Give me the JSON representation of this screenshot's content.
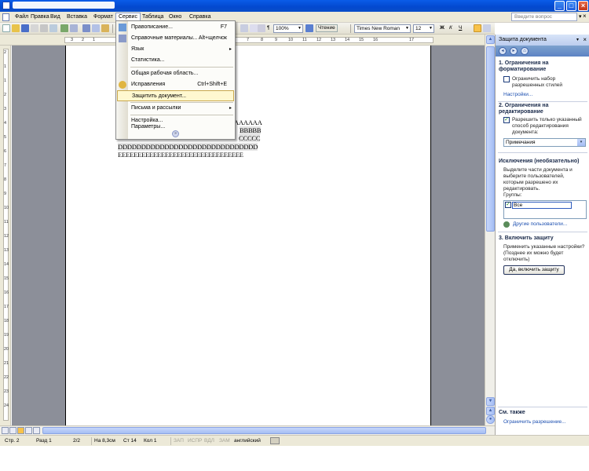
{
  "window": {
    "title": "",
    "minimize": "_",
    "maximize": "□",
    "close": "×"
  },
  "menubar": {
    "items": [
      "Файл",
      "Правка",
      "Вид",
      "Вставка",
      "Формат",
      "Сервис",
      "Таблица",
      "Окно",
      "Справка"
    ],
    "active": "Сервис",
    "help_placeholder": "Введите вопрос",
    "help_arrow": "▾",
    "close_doc": "×"
  },
  "toolbar": {
    "zoom": "100%",
    "read_button": "Чтение",
    "font": "Times New Roman",
    "size": "12",
    "bold": "Ж",
    "italic": "К",
    "underline": "Ч",
    "paragraph_mark": "¶",
    "font_color": "A"
  },
  "ruler": {
    "h_ticks": [
      "3",
      "2",
      "1",
      "1",
      "2",
      "3",
      "4",
      "5",
      "6",
      "7",
      "8",
      "9",
      "10",
      "11",
      "12",
      "13",
      "14",
      "15",
      "16",
      "17"
    ],
    "v_ticks": [
      "2",
      "1",
      "1",
      "2",
      "3",
      "4",
      "5",
      "6",
      "7",
      "8",
      "9",
      "10",
      "11",
      "12",
      "13",
      "14",
      "15",
      "16",
      "17",
      "18",
      "19",
      "20",
      "21",
      "22",
      "23",
      "24"
    ]
  },
  "document": {
    "lines": [
      "AAAAAA",
      "BBBBB",
      "CCCCC",
      "DDDDDDDDDDDDDDDDDDDDDDDDDDDDDD",
      "EEEEEEEEEEEEEEEEEEEEEEEEEEEEEEEE"
    ]
  },
  "dropdown": {
    "items": [
      {
        "label": "Правописание...",
        "key": "F7",
        "icon": "spelling-icon"
      },
      {
        "label": "Справочные материалы...",
        "key": "Alt+щелчок",
        "icon": "research-icon"
      },
      {
        "label": "Язык",
        "submenu": true
      },
      {
        "label": "Статистика..."
      },
      {
        "label": "Общая рабочая область..."
      },
      {
        "label": "Исправления",
        "key": "Ctrl+Shift+E",
        "icon": "track-changes-icon"
      },
      {
        "label": "Защитить документ...",
        "highlighted": true
      },
      {
        "label": "Письма и рассылки",
        "submenu": true
      },
      {
        "label": "Настройка..."
      },
      {
        "label": "Параметры..."
      }
    ],
    "submenu_arrow": "▸",
    "more_arrow": "»"
  },
  "statusbar": {
    "page": "Стр. 2",
    "section": "Разд 1",
    "pages": "2/2",
    "position": "На 8,3см",
    "line": "Ст 14",
    "column": "Кол 1",
    "rec": "ЗАП",
    "trk": "ИСПР",
    "ext": "ВДЛ",
    "ovr": "ЗАМ",
    "language": "английский"
  },
  "taskpane": {
    "title": "Защита документа",
    "dropdown_arrow": "▾",
    "close": "×",
    "nav": {
      "back": "◂",
      "forward": "▸",
      "home": "⌂"
    },
    "section1": {
      "heading": "1. Ограничения на форматирование",
      "checkbox_label": "Ограничить набор разрешенных стилей",
      "checked": false,
      "link": "Настройки..."
    },
    "section2": {
      "heading": "2. Ограничения на редактирование",
      "checkbox_label": "Разрешить только указанный способ редактирования документа:",
      "checked": true,
      "select_value": "Примечания",
      "select_arrow": "▾"
    },
    "exceptions": {
      "heading": "Исключения (необязательно)",
      "text": "Выделите части документа и выберите пользователей, которым разрешено их редактировать.",
      "groups_label": "Группы:",
      "group_item": "Все",
      "group_checked": true,
      "more_users": "Другие пользователи...",
      "checkmark": "✓"
    },
    "section3": {
      "heading": "3. Включить защиту",
      "text": "Применить указанные настройки? (Позднее их можно будет отключить)",
      "button": "Да, включить защиту"
    },
    "see_also": {
      "heading": "См. также",
      "link": "Ограничить разрешение..."
    }
  }
}
